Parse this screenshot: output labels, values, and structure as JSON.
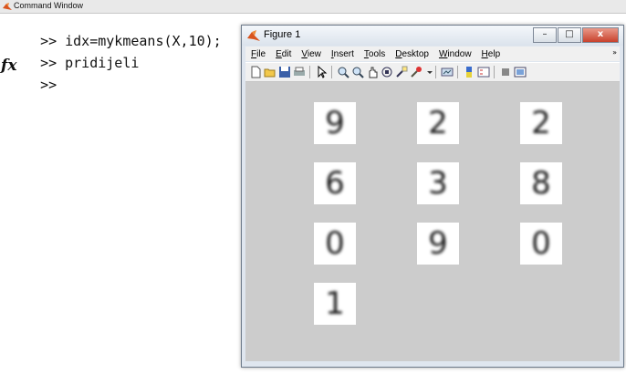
{
  "command_window": {
    "title": "Command Window",
    "prompt": ">>",
    "fx_symbol": "fx",
    "lines": [
      "idx=mykmeans(X,10);",
      "pridijeli",
      ""
    ]
  },
  "figure": {
    "title": "Figure 1",
    "window_buttons": {
      "minimize": "–",
      "maximize": "□",
      "close": "x"
    },
    "menu": [
      {
        "u": "F",
        "rest": "ile"
      },
      {
        "u": "E",
        "rest": "dit"
      },
      {
        "u": "V",
        "rest": "iew"
      },
      {
        "u": "I",
        "rest": "nsert"
      },
      {
        "u": "T",
        "rest": "ools"
      },
      {
        "u": "D",
        "rest": "esktop"
      },
      {
        "u": "W",
        "rest": "indow"
      },
      {
        "u": "H",
        "rest": "elp"
      }
    ],
    "menu_overflow": "»",
    "toolbar_icons": [
      "new-figure-icon",
      "open-file-icon",
      "save-icon",
      "print-icon",
      "pointer-icon",
      "zoom-in-icon",
      "zoom-out-icon",
      "pan-icon",
      "rotate-3d-icon",
      "data-cursor-icon",
      "brush-icon",
      "link-icon",
      "colorbar-icon",
      "legend-icon",
      "hide-plot-tools-icon",
      "show-plot-tools-icon"
    ],
    "cluster_digits": [
      "9",
      "2",
      "2",
      "6",
      "3",
      "8",
      "0",
      "9",
      "0",
      "1"
    ],
    "accent_color": "#cccccc"
  }
}
